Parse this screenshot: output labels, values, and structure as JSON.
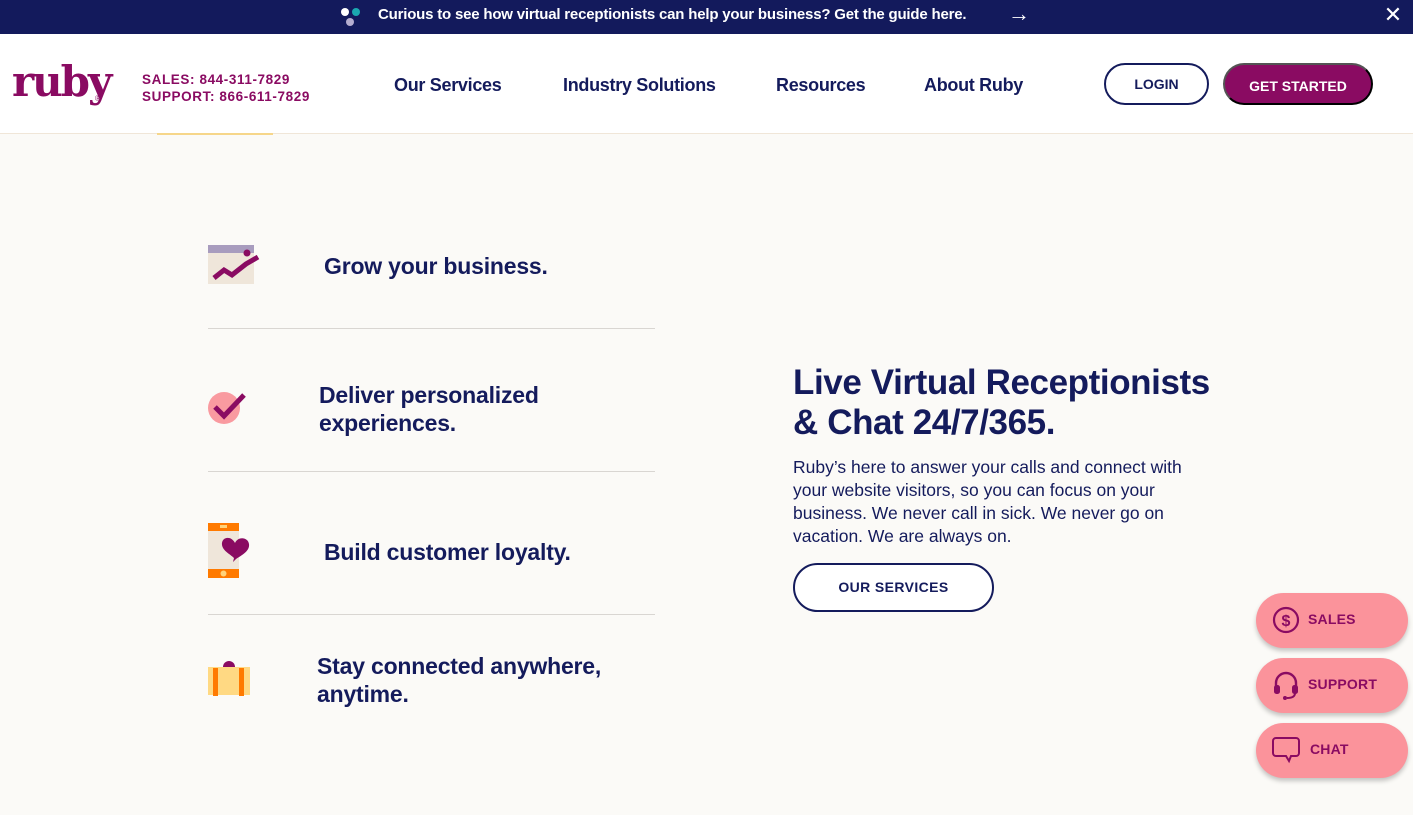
{
  "banner": {
    "text": "Curious to see how virtual receptionists can help your business? Get the guide here.",
    "arrow_icon": "→",
    "close_icon": "✕"
  },
  "header": {
    "logo": "ruby",
    "logo_reg": "®",
    "sales_phone": "SALES: 844-311-7829",
    "support_phone": "SUPPORT: 866-611-7829",
    "nav": [
      {
        "label": "Our Services"
      },
      {
        "label": "Industry Solutions"
      },
      {
        "label": "Resources"
      },
      {
        "label": "About Ruby"
      }
    ],
    "login_label": "LOGIN",
    "get_started_label": "GET STARTED"
  },
  "features": [
    {
      "title": "Grow your business.",
      "icon": "growth-chart-icon"
    },
    {
      "title": "Deliver personalized experiences.",
      "icon": "checkmark-icon"
    },
    {
      "title": "Build customer loyalty.",
      "icon": "phone-heart-icon"
    },
    {
      "title": "Stay connected anywhere, anytime.",
      "icon": "briefcase-icon"
    }
  ],
  "hero": {
    "title": "Live Virtual Receptionists & Chat 24/7/365.",
    "body": "Ruby’s here to answer your calls and connect with your website visitors, so you can focus on your business. We never call in sick. We never go on vacation. We are always on.",
    "button_label": "OUR SERVICES"
  },
  "contact_widget": [
    {
      "label": "SALES",
      "icon": "dollar-icon"
    },
    {
      "label": "SUPPORT",
      "icon": "headset-icon"
    },
    {
      "label": "CHAT",
      "icon": "chat-bubble-icon"
    }
  ],
  "colors": {
    "navy": "#141b5c",
    "banner": "#131a5c",
    "brand_magenta": "#8a0b62",
    "widget_pink": "#fb939b",
    "background": "#fbfaf7"
  }
}
